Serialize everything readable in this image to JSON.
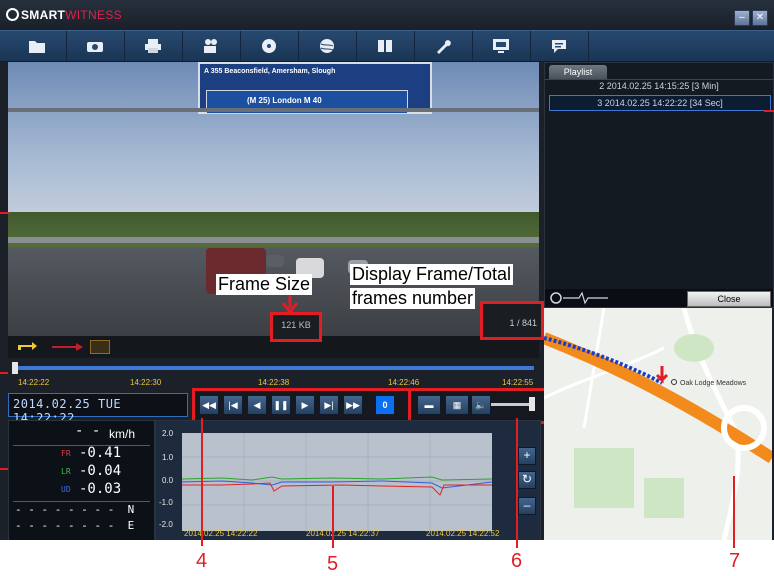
{
  "app": {
    "logo_bold": "SMART",
    "logo_light": "WITNESS",
    "win_minimize": "–",
    "win_close": "✕"
  },
  "toolbar": {
    "icons": [
      "folder-icon",
      "camera-icon",
      "printer-icon",
      "video-camera-icon",
      "disc-icon",
      "globe-icon",
      "book-icon",
      "wrench-icon",
      "monitor-icon",
      "chat-icon"
    ]
  },
  "video": {
    "sign_top": "A 355   Beaconsfield, Amersham, Slough",
    "sign_bottom": "(M 25) London  M 40"
  },
  "annotations": {
    "frame_size_label": "Frame Size",
    "display_frame_label_1": "Display Frame/Total",
    "display_frame_label_2": "frames number",
    "num_4": "4",
    "num_5": "5",
    "num_6": "6",
    "num_7": "7"
  },
  "status": {
    "frame_size": "121 KB",
    "frame_count": "1 / 841"
  },
  "timeline": {
    "ticks": [
      "14:22:22",
      "14:22:30",
      "14:22:38",
      "14:22:46",
      "14:22:55"
    ]
  },
  "datetime": "2014.02.25 TUE  14:22:22",
  "controls": {
    "counter": "0"
  },
  "speed": {
    "value": "- -",
    "unit": "km/h",
    "fr_label": "FR",
    "fr_value": "-0.41",
    "lr_label": "LR",
    "lr_value": "-0.04",
    "ud_label": "UD",
    "ud_value": "-0.03",
    "lat": "- - - - - - - -  N",
    "lon": "- - - - - - - -  E"
  },
  "graph": {
    "y_ticks": [
      "2.0",
      "1.0",
      "0.0",
      "-1.0",
      "-2.0"
    ],
    "x_ticks": [
      "2014.02.25 14:22:22",
      "2014.02.25 14:22:37",
      "2014.02.25 14:22:52"
    ],
    "btn_plus": "+",
    "btn_reset": "↻",
    "btn_minus": "–"
  },
  "playlist": {
    "tab": "Playlist",
    "items": [
      {
        "label": "2  2014.02.25 14:15:25  [3 Min]",
        "selected": false
      },
      {
        "label": "3  2014.02.25 14:22:22  [34 Sec]",
        "selected": true
      }
    ],
    "close_label": "Close"
  },
  "map": {
    "poi_label": "Oak Lodge Meadows"
  }
}
